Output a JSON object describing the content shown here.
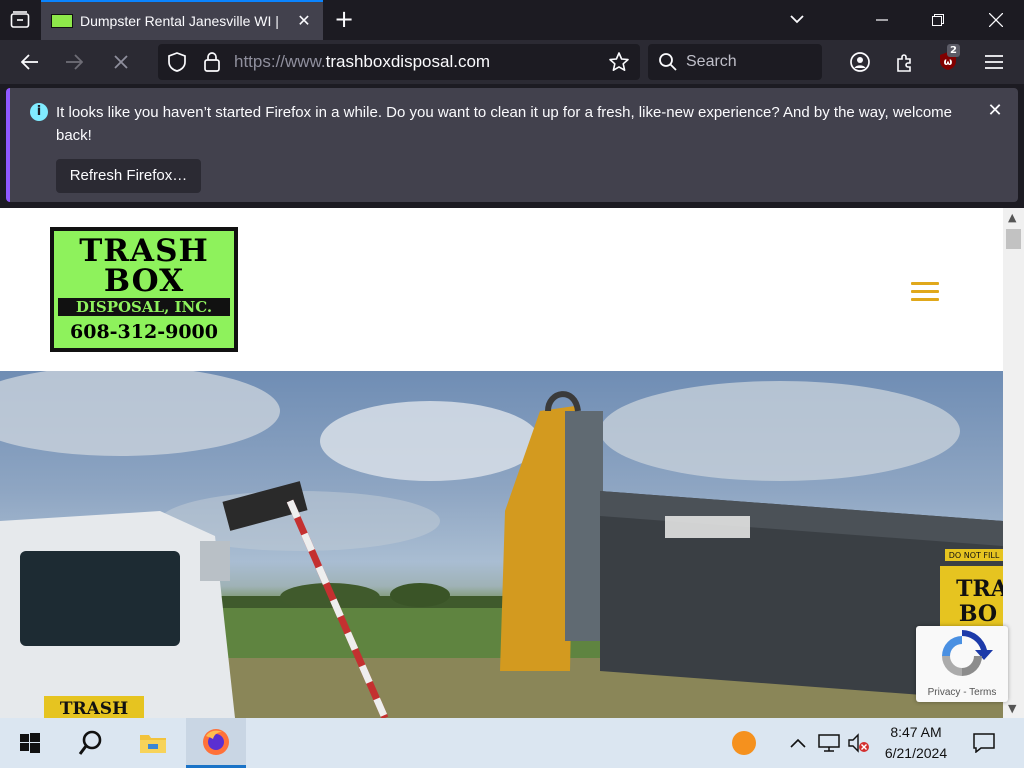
{
  "browser": {
    "tab": {
      "title": "Dumpster Rental Janesville WI |"
    },
    "url": {
      "prefix": "https://www.",
      "domain": "trashboxdisposal.com"
    },
    "search_placeholder": "Search",
    "extension_badge": "2",
    "accent_color": "#0a84ff"
  },
  "notification": {
    "message": "It looks like you haven’t started Firefox in a while. Do you want to clean it up for a fresh, like-new experience? And by the way, welcome back!",
    "refresh_label": "Refresh Firefox…"
  },
  "site": {
    "logo": {
      "line1": "TRASH",
      "line2": "BOX",
      "line3": "DISPOSAL, INC.",
      "line4": "608-312-9000",
      "color": "#8ef25c"
    },
    "menu_color": "#e0a81b",
    "hero": {
      "truck_text": "TRASH",
      "dumpster_text1": "TRA",
      "dumpster_text2": "BO",
      "sticker_text": "DO NOT FILL"
    },
    "recaptcha": {
      "privacy": "Privacy",
      "separator": " - ",
      "terms": "Terms"
    }
  },
  "taskbar": {
    "time": "8:47 AM",
    "date": "6/21/2024"
  }
}
